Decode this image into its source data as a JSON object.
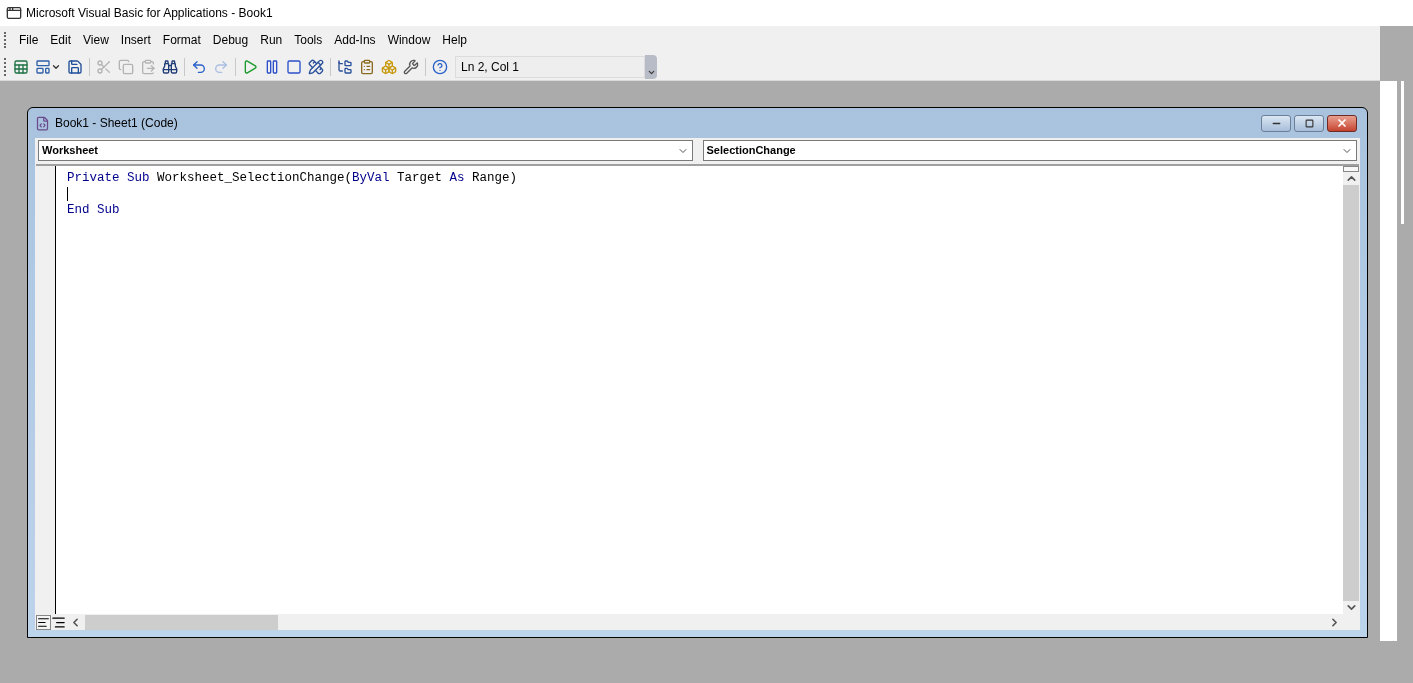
{
  "window": {
    "title": "Microsoft Visual Basic for Applications - Book1"
  },
  "menu": [
    "File",
    "Edit",
    "View",
    "Insert",
    "Format",
    "Debug",
    "Run",
    "Tools",
    "Add-Ins",
    "Window",
    "Help"
  ],
  "toolbar": {
    "groups": [
      {
        "buttons": [
          {
            "kind": "excel",
            "disabled": false
          },
          {
            "kind": "userform",
            "disabled": false
          },
          {
            "kind": "save",
            "disabled": false
          }
        ]
      },
      {
        "buttons": [
          {
            "kind": "cut",
            "disabled": true
          },
          {
            "kind": "copy",
            "disabled": true
          },
          {
            "kind": "paste",
            "disabled": true
          },
          {
            "kind": "find",
            "disabled": false
          }
        ]
      },
      {
        "buttons": [
          {
            "kind": "undo",
            "disabled": false
          },
          {
            "kind": "redo",
            "disabled": true
          }
        ]
      },
      {
        "buttons": [
          {
            "kind": "run",
            "disabled": false
          },
          {
            "kind": "pause",
            "disabled": false
          },
          {
            "kind": "stop",
            "disabled": false
          },
          {
            "kind": "design",
            "disabled": false
          }
        ]
      },
      {
        "buttons": [
          {
            "kind": "explorer",
            "disabled": false
          },
          {
            "kind": "properties",
            "disabled": false
          },
          {
            "kind": "browser",
            "disabled": false
          },
          {
            "kind": "toolbox",
            "disabled": false
          }
        ]
      },
      {
        "buttons": [
          {
            "kind": "help",
            "disabled": false
          }
        ]
      }
    ],
    "position": "Ln 2, Col 1"
  },
  "code_window": {
    "title": "Book1 - Sheet1 (Code)",
    "object_dropdown": "Worksheet",
    "procedure_dropdown": "SelectionChange",
    "lines": [
      {
        "cursor": false,
        "tokens": [
          {
            "kind": "keyword",
            "text": "Private Sub"
          },
          {
            "kind": "plain",
            "text": " Worksheet_SelectionChange("
          },
          {
            "kind": "keyword",
            "text": "ByVal"
          },
          {
            "kind": "plain",
            "text": " Target "
          },
          {
            "kind": "keyword",
            "text": "As"
          },
          {
            "kind": "plain",
            "text": " Range)"
          }
        ]
      },
      {
        "cursor": true
      },
      {
        "cursor": false,
        "tokens": [
          {
            "kind": "keyword",
            "text": "End Sub"
          }
        ]
      }
    ]
  }
}
